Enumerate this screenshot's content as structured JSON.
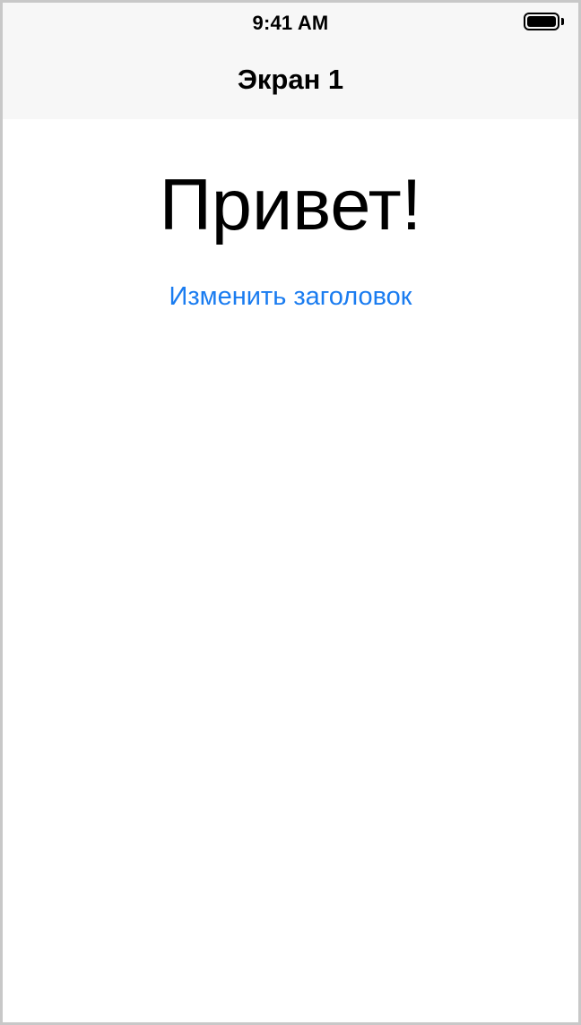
{
  "status_bar": {
    "time": "9:41 AM",
    "battery_icon": "battery-full-icon"
  },
  "navigation": {
    "title": "Экран 1"
  },
  "main": {
    "headline": "Привет!",
    "change_title_button": "Изменить заголовок"
  },
  "colors": {
    "link": "#1a7cf0",
    "navigation_background": "#f7f7f7",
    "separator": "#b9b9b9"
  }
}
